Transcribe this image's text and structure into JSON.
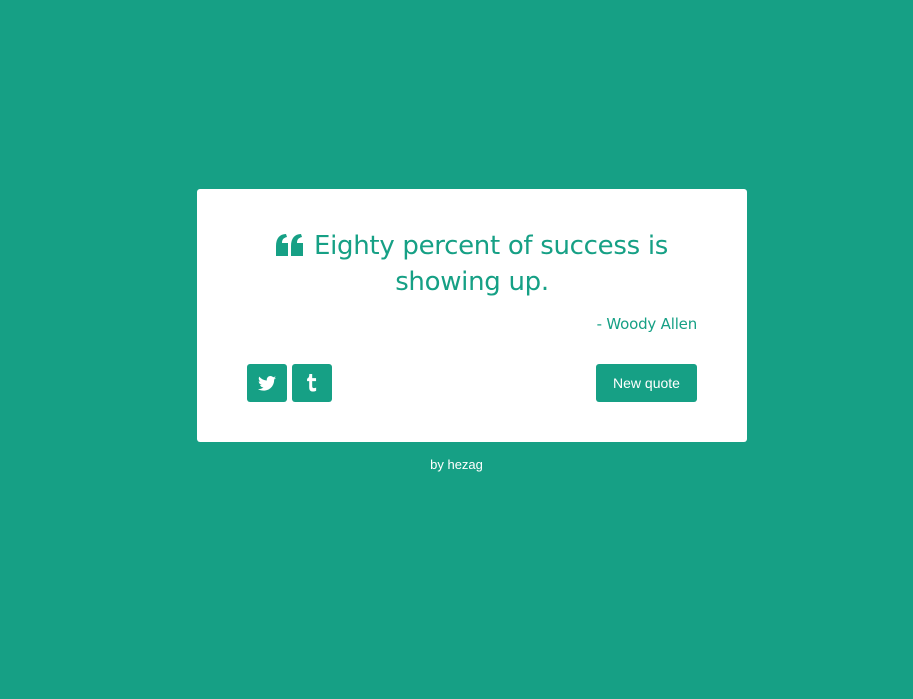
{
  "quote": {
    "text": "Eighty percent of success is showing up.",
    "author": "- Woody Allen"
  },
  "actions": {
    "twitter_icon": "twitter-icon",
    "tumblr_icon": "tumblr-icon",
    "new_quote_label": "New quote"
  },
  "footer": {
    "prefix": "by",
    "author_link": "hezag"
  },
  "colors": {
    "background": "#16a085",
    "card": "#ffffff",
    "accent": "#16a085"
  }
}
